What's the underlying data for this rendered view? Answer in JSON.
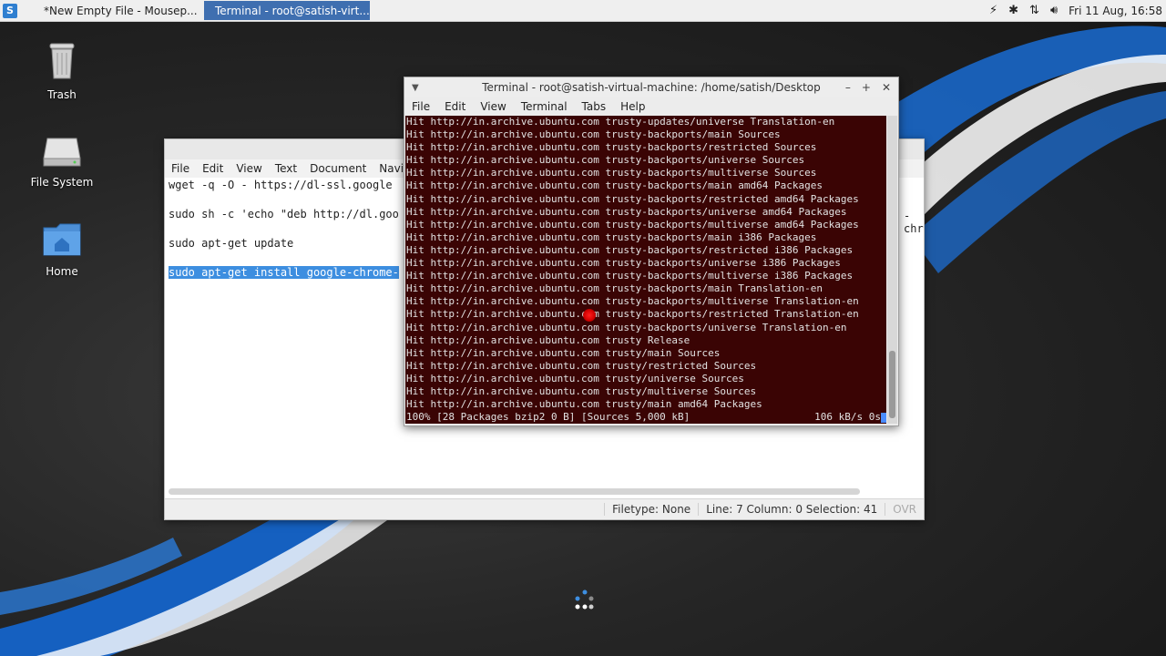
{
  "panel": {
    "menu_icon": "S",
    "tasks": [
      {
        "label": "*New Empty File - Mousep...",
        "icon": "editor-icon"
      },
      {
        "label": "Terminal - root@satish-virt...",
        "icon": "terminal-icon"
      }
    ],
    "clock": "Fri 11 Aug, 16:58",
    "tray_icons": [
      "power-icon",
      "bluetooth-icon",
      "network-icon",
      "volume-icon"
    ]
  },
  "desktop": {
    "icons": [
      {
        "label": "Trash",
        "icon": "trash-icon"
      },
      {
        "label": "File System",
        "icon": "drive-icon"
      },
      {
        "label": "Home",
        "icon": "home-folder-icon"
      }
    ]
  },
  "mousepad": {
    "menu": [
      "File",
      "Edit",
      "View",
      "Text",
      "Document",
      "Navig"
    ],
    "lines": [
      "wget -q -O - https://dl-ssl.google",
      "",
      "sudo sh -c 'echo \"deb http://dl.goo",
      "",
      "sudo apt-get update",
      "",
      "sudo apt-get install google-chrome-"
    ],
    "overflow_text": "-chr",
    "status": {
      "filetype": "Filetype: None",
      "position": "Line: 7 Column: 0 Selection: 41",
      "mode": "OVR"
    }
  },
  "terminal": {
    "title": "Terminal - root@satish-virtual-machine: /home/satish/Desktop",
    "menu": [
      "File",
      "Edit",
      "View",
      "Terminal",
      "Tabs",
      "Help"
    ],
    "lines": [
      "Hit http://in.archive.ubuntu.com trusty-updates/universe Translation-en",
      "Hit http://in.archive.ubuntu.com trusty-backports/main Sources",
      "Hit http://in.archive.ubuntu.com trusty-backports/restricted Sources",
      "Hit http://in.archive.ubuntu.com trusty-backports/universe Sources",
      "Hit http://in.archive.ubuntu.com trusty-backports/multiverse Sources",
      "Hit http://in.archive.ubuntu.com trusty-backports/main amd64 Packages",
      "Hit http://in.archive.ubuntu.com trusty-backports/restricted amd64 Packages",
      "Hit http://in.archive.ubuntu.com trusty-backports/universe amd64 Packages",
      "Hit http://in.archive.ubuntu.com trusty-backports/multiverse amd64 Packages",
      "Hit http://in.archive.ubuntu.com trusty-backports/main i386 Packages",
      "Hit http://in.archive.ubuntu.com trusty-backports/restricted i386 Packages",
      "Hit http://in.archive.ubuntu.com trusty-backports/universe i386 Packages",
      "Hit http://in.archive.ubuntu.com trusty-backports/multiverse i386 Packages",
      "Hit http://in.archive.ubuntu.com trusty-backports/main Translation-en",
      "Hit http://in.archive.ubuntu.com trusty-backports/multiverse Translation-en",
      "Hit http://in.archive.ubuntu.com trusty-backports/restricted Translation-en",
      "Hit http://in.archive.ubuntu.com trusty-backports/universe Translation-en",
      "Hit http://in.archive.ubuntu.com trusty Release",
      "Hit http://in.archive.ubuntu.com trusty/main Sources",
      "Hit http://in.archive.ubuntu.com trusty/restricted Sources",
      "Hit http://in.archive.ubuntu.com trusty/universe Sources",
      "Hit http://in.archive.ubuntu.com trusty/multiverse Sources",
      "Hit http://in.archive.ubuntu.com trusty/main amd64 Packages"
    ],
    "progress_left": "100% [28 Packages bzip2 0 B] [Sources 5,000 kB]",
    "progress_right": "106 kB/s 0s",
    "colors": {
      "background": "#3a0404",
      "text": "#e2e2e2",
      "cursor": "#4a8cff"
    }
  }
}
